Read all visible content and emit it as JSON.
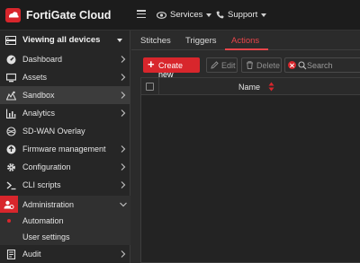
{
  "app": {
    "title": "FortiGate Cloud"
  },
  "topnav": {
    "services": "Services",
    "support": "Support"
  },
  "sidebar": {
    "scope_label": "Viewing all devices",
    "items": [
      {
        "label": "Dashboard",
        "icon": "dashboard-icon"
      },
      {
        "label": "Assets",
        "icon": "assets-icon"
      },
      {
        "label": "Sandbox",
        "icon": "sandbox-icon"
      },
      {
        "label": "Analytics",
        "icon": "analytics-icon"
      },
      {
        "label": "SD-WAN Overlay",
        "icon": "sdwan-icon"
      },
      {
        "label": "Firmware management",
        "icon": "firmware-icon"
      },
      {
        "label": "Configuration",
        "icon": "gear-icon"
      },
      {
        "label": "CLI scripts",
        "icon": "terminal-icon"
      },
      {
        "label": "Administration",
        "icon": "admin-users-icon"
      },
      {
        "label": "Audit",
        "icon": "audit-icon"
      }
    ],
    "sub_items": [
      {
        "label": "Automation"
      },
      {
        "label": "User settings"
      }
    ]
  },
  "tabs": [
    {
      "label": "Stitches"
    },
    {
      "label": "Triggers"
    },
    {
      "label": "Actions"
    }
  ],
  "toolbar": {
    "create_label": "Create new",
    "edit_label": "Edit",
    "delete_label": "Delete",
    "search_placeholder": "Search"
  },
  "table": {
    "columns": [
      "Name"
    ],
    "rows": []
  },
  "colors": {
    "accent": "#d8262c",
    "background": "#2b2b2b"
  }
}
